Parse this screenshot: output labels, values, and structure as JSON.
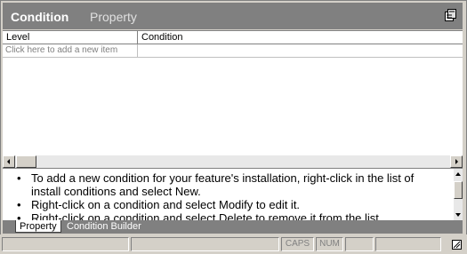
{
  "title": {
    "main": "Condition",
    "sub": "Property",
    "icon": "property-pages-icon"
  },
  "grid": {
    "columns": [
      "Level",
      "Condition"
    ],
    "new_row_placeholder": "Click here to add a new item"
  },
  "help": {
    "items": [
      "To add a new condition for your feature's installation, right-click in the list of install conditions and select New.",
      "Right-click on a condition and select Modify to edit it.",
      "Right-click on a condition and select Delete to remove it from the list."
    ]
  },
  "tabs": [
    {
      "label": "Property",
      "active": true
    },
    {
      "label": "Condition Builder",
      "active": false
    }
  ],
  "status": {
    "caps": "CAPS",
    "num": "NUM"
  }
}
